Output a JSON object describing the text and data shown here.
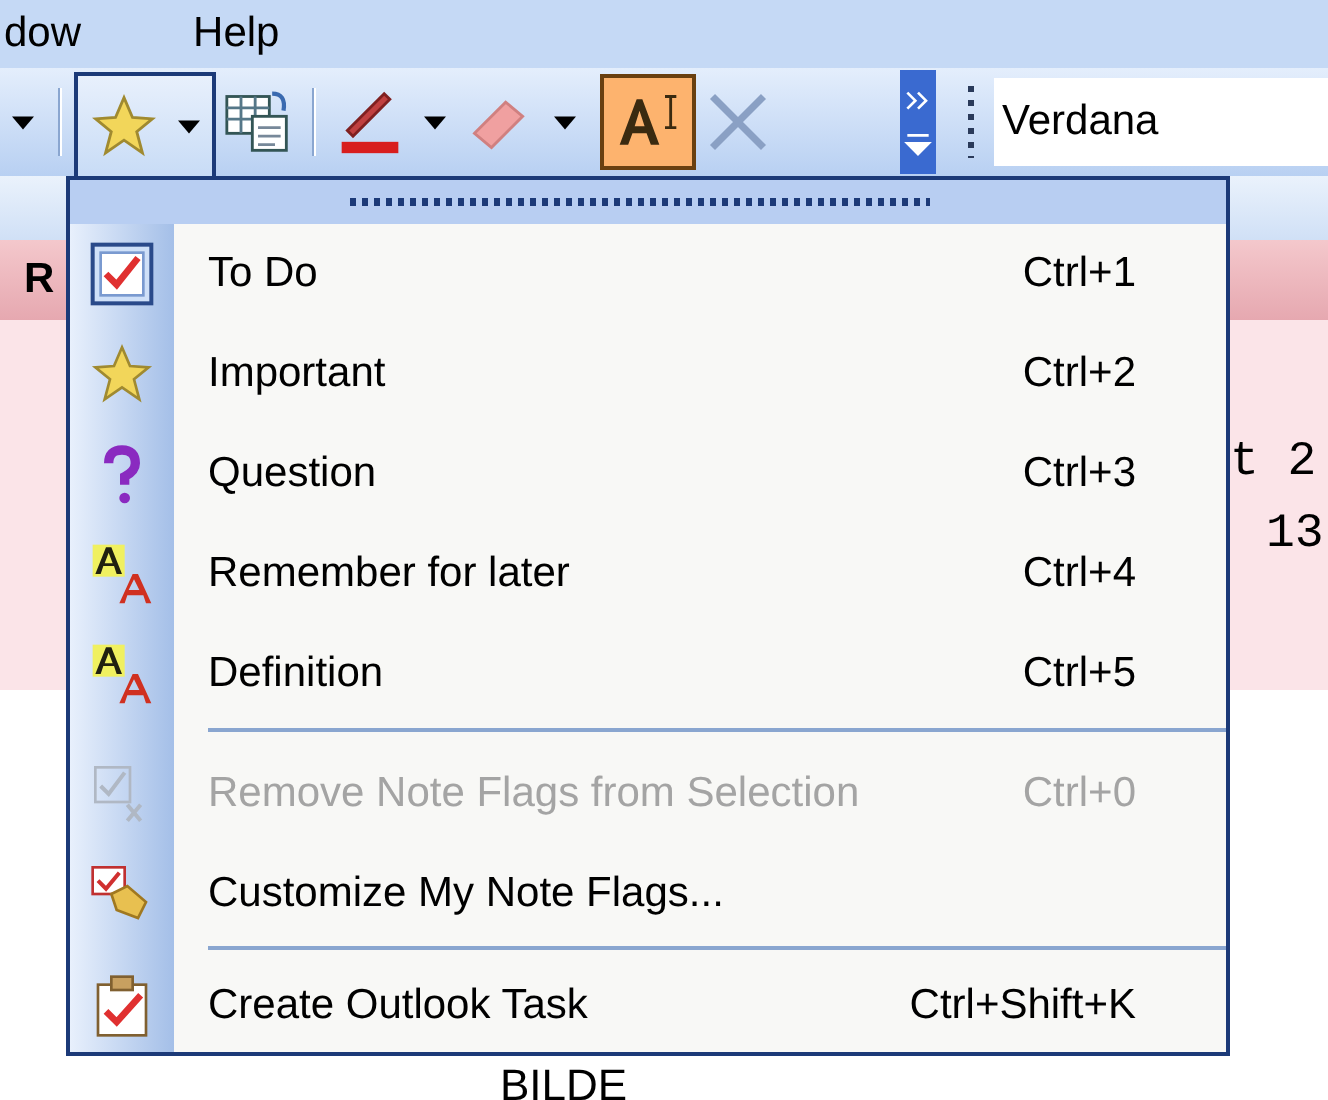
{
  "menubar": [
    {
      "label": "dow"
    },
    {
      "label": "Help"
    }
  ],
  "toolbar": {
    "flags_button": {
      "open": true
    },
    "highlight_button": {
      "selected": true
    },
    "clear_button": {
      "disabled": true
    },
    "font_field": {
      "value": "Verdana"
    }
  },
  "document": {
    "heading": "R",
    "lines": [
      "t 2",
      "13"
    ],
    "caption": "BILDE"
  },
  "flags_menu": [
    {
      "kind": "item",
      "label": "To Do",
      "shortcut": "Ctrl+1",
      "disabled": false
    },
    {
      "kind": "item",
      "label": "Important",
      "shortcut": "Ctrl+2",
      "disabled": false
    },
    {
      "kind": "item",
      "label": "Question",
      "shortcut": "Ctrl+3",
      "disabled": false
    },
    {
      "kind": "item",
      "label": "Remember for later",
      "shortcut": "Ctrl+4",
      "disabled": false
    },
    {
      "kind": "item",
      "label": "Definition",
      "shortcut": "Ctrl+5",
      "disabled": false
    },
    {
      "kind": "separator"
    },
    {
      "kind": "item",
      "label": "Remove Note Flags from Selection",
      "shortcut": "Ctrl+0",
      "disabled": true
    },
    {
      "kind": "item",
      "label": "Customize My Note Flags...",
      "disabled": false
    },
    {
      "kind": "separator"
    },
    {
      "kind": "item",
      "label": "Create Outlook Task",
      "shortcut": "Ctrl+Shift+K",
      "disabled": false
    }
  ]
}
